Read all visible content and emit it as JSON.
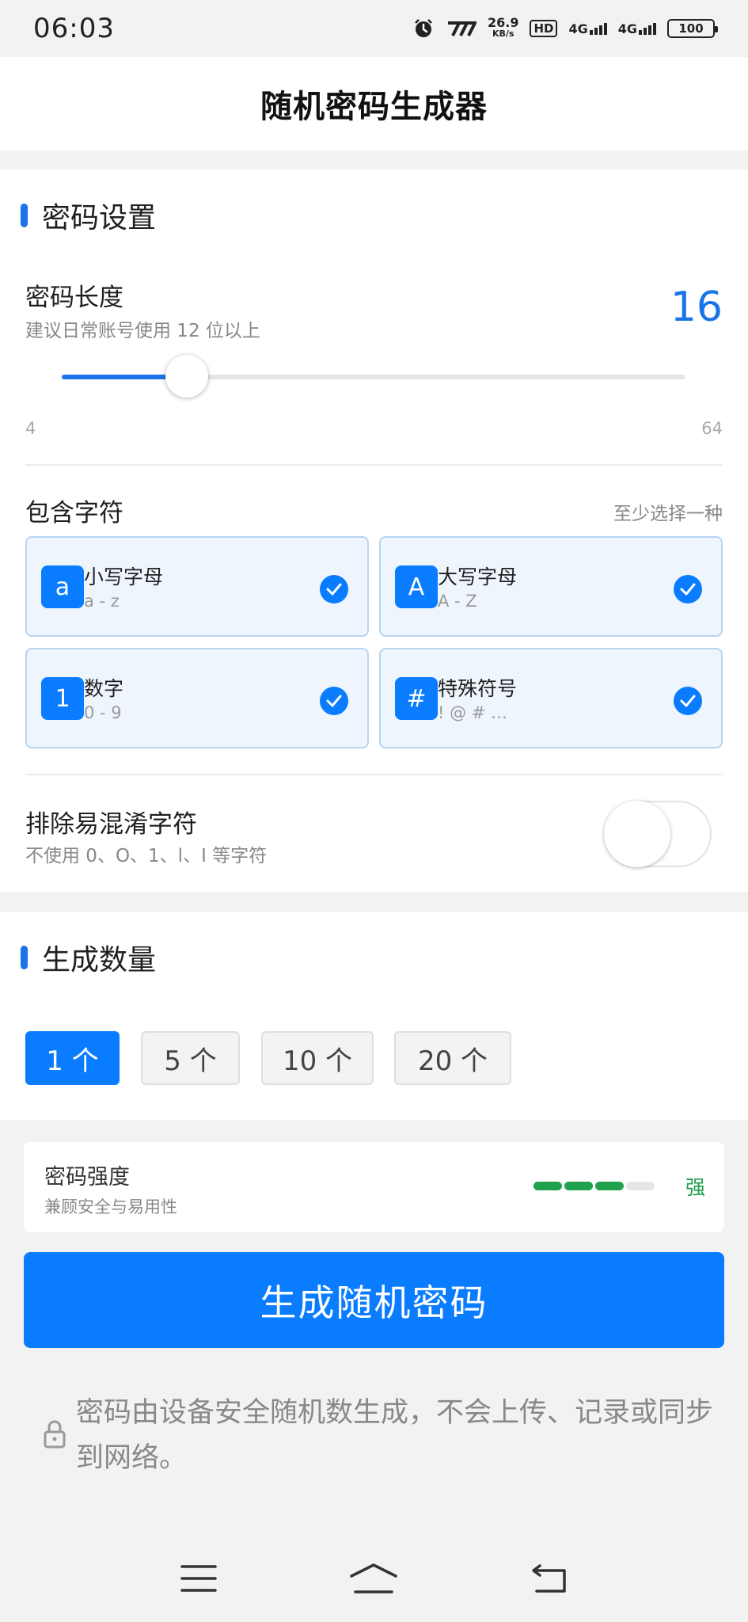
{
  "status_bar": {
    "time": "06:03",
    "network_speed_value": "26.9",
    "network_speed_unit": "KB/s",
    "hd_label": "HD",
    "sim1_label": "4G",
    "sim2_label": "4G",
    "battery": "100"
  },
  "app": {
    "title": "随机密码生成器"
  },
  "settings": {
    "section_title": "密码设置",
    "length": {
      "title": "密码长度",
      "hint": "建议日常账号使用 12 位以上",
      "value": "16",
      "min_label": "4",
      "max_label": "64",
      "fraction": 0.2
    },
    "chars": {
      "title": "包含字符",
      "hint": "至少选择一种",
      "options": [
        {
          "icon": "a",
          "name": "小写字母",
          "sample": "a - z",
          "checked": true
        },
        {
          "icon": "A",
          "name": "大写字母",
          "sample": "A - Z",
          "checked": true
        },
        {
          "icon": "1",
          "name": "数字",
          "sample": "0 - 9",
          "checked": true
        },
        {
          "icon": "#",
          "name": "特殊符号",
          "sample": "! @ # …",
          "checked": true
        }
      ]
    },
    "exclude": {
      "title": "排除易混淆字符",
      "hint": "不使用 0、O、1、l、I 等字符",
      "enabled": false
    }
  },
  "count": {
    "section_title": "生成数量",
    "options": [
      "1 个",
      "5 个",
      "10 个",
      "20 个"
    ],
    "selected_index": 0
  },
  "strength": {
    "title": "密码强度",
    "hint": "兼顾安全与易用性",
    "label": "强",
    "level": 3,
    "max_level": 4,
    "color": "#1fa14d"
  },
  "generate_button": "生成随机密码",
  "note": "密码由设备安全随机数生成，不会上传、记录或同步到网络。",
  "colors": {
    "accent": "#0a7cff",
    "strength": "#1fa14d"
  },
  "nav": {
    "icons": [
      "menu-icon",
      "home-icon",
      "back-icon"
    ]
  }
}
